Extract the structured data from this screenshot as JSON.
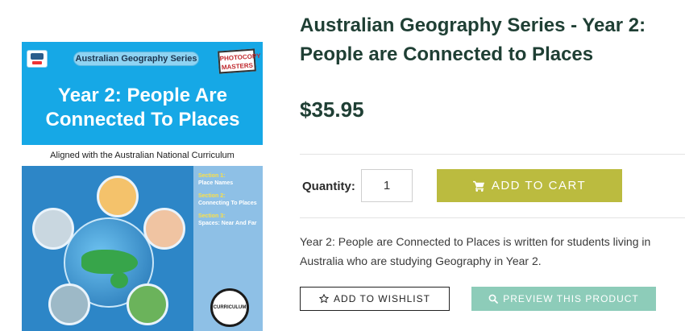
{
  "cover": {
    "series_label": "Australian Geography Series",
    "badge_text": "PHOTOCOPY MASTERS",
    "title": "Year 2: People Are Connected To Places",
    "strip_text": "Aligned with the Australian National Curriculum",
    "sections": [
      {
        "heading": "Section 1:",
        "name": "Place Names"
      },
      {
        "heading": "Section 2:",
        "name": "Connecting To Places"
      },
      {
        "heading": "Section 3:",
        "name": "Spaces: Near And Far"
      }
    ],
    "seal_text": "CURRICULUM LINKED"
  },
  "product": {
    "title": "Australian Geography Series - Year 2: People are Connected to Places",
    "price": "$35.95",
    "quantity_label": "Quantity:",
    "quantity_value": "1",
    "add_to_cart_label": "ADD TO CART",
    "description": "Year 2: People are Connected to Places is written for students living in Australia who are studying Geography in Year 2.",
    "wishlist_label": "ADD TO WISHLIST",
    "preview_label": "PREVIEW THIS PRODUCT"
  },
  "colors": {
    "title": "#1f3f34",
    "cart_button": "#bbbb3f",
    "preview_button": "#8dccb9",
    "cover_blue": "#16a8e6"
  },
  "icons": {
    "cart": "shopping-cart-icon",
    "wishlist": "star-outline-icon",
    "preview": "search-icon"
  }
}
